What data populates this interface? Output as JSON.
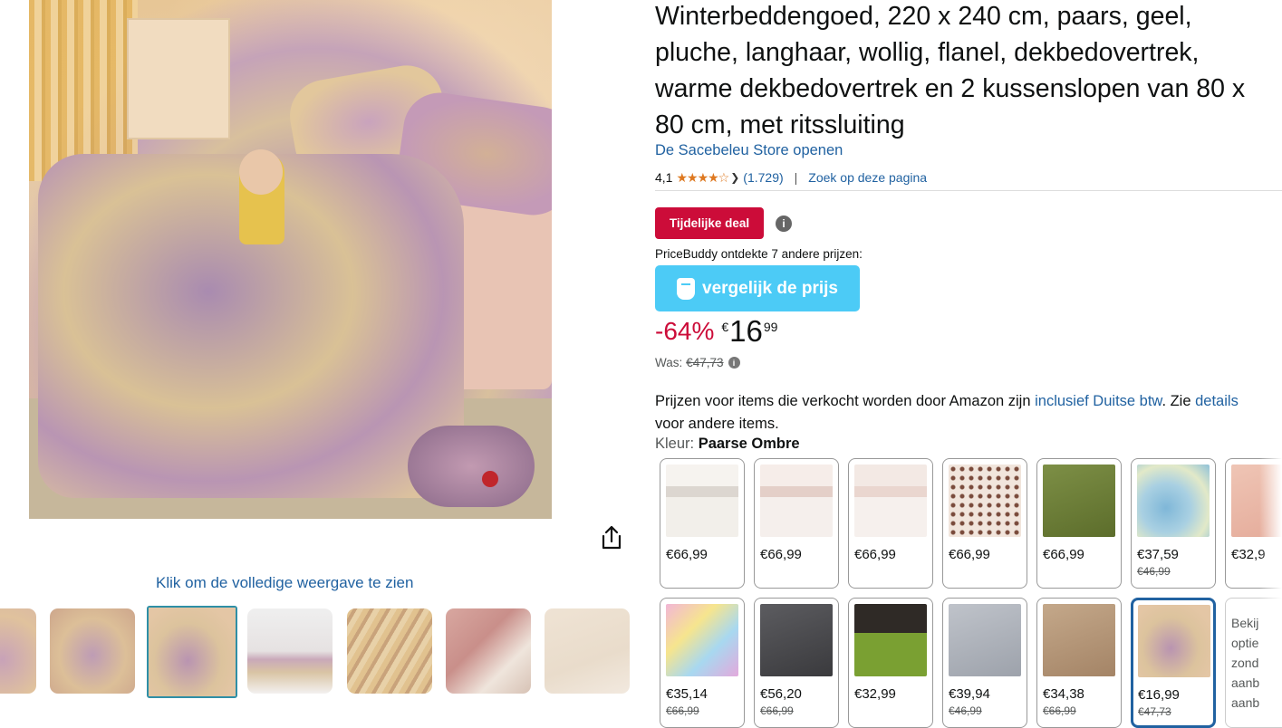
{
  "gallery": {
    "full_view_label": "Klik om de volledige weergave te zien",
    "thumbnails": 7,
    "selected_index": 2
  },
  "product": {
    "title_lines": [
      "Winterbeddengoed, 220 x 240 cm, paars, geel,",
      "pluche, langhaar, wollig, flanel, dekbedovertrek,",
      "warme dekbedovertrek en 2 kussenslopen van 80 x",
      "80 cm, met ritssluiting"
    ],
    "store_link": "De Sacebeleu Store openen",
    "rating": "4,1",
    "stars": "★★★★☆",
    "rating_count": "(1.729)",
    "search_link": "Zoek op deze pagina"
  },
  "deal": {
    "badge": "Tijdelijke deal",
    "pricebuddy_text": "PriceBuddy ontdekte 7 andere prijzen:",
    "compare_label": "vergelijk de prijs"
  },
  "price": {
    "discount": "-64%",
    "currency": "€",
    "whole": "16",
    "fraction": "99",
    "was_label": "Was:",
    "was_value": "€47,73"
  },
  "vat": {
    "part1": "Prijzen voor items die verkocht worden door Amazon zijn ",
    "link1": "inclusief Duitse btw",
    "part2": ". Zie ",
    "link2": "details",
    "line2": "voor andere items."
  },
  "color": {
    "label": "Kleur:",
    "value": "Paarse Ombre"
  },
  "swatches": [
    {
      "price": "€66,99",
      "old": "",
      "color": "#e9e2da"
    },
    {
      "price": "€66,99",
      "old": "",
      "color": "#ece4e0"
    },
    {
      "price": "€66,99",
      "old": "",
      "color": "#eee3de"
    },
    {
      "price": "€66,99",
      "old": "",
      "color": "#e8d4c8"
    },
    {
      "price": "€66,99",
      "old": "",
      "color": "#6b7d3a"
    },
    {
      "price": "€37,59",
      "old": "€46,99",
      "color": "#7fb5d6"
    },
    {
      "price": "€32,9",
      "old": "",
      "color": "#e6b7a7"
    },
    {
      "price": "€35,14",
      "old": "€66,99",
      "color": "#e7b7d3"
    },
    {
      "price": "€56,20",
      "old": "€66,99",
      "color": "#4a4a4c"
    },
    {
      "price": "€32,99",
      "old": "",
      "color": "#6e8c2d"
    },
    {
      "price": "€39,94",
      "old": "€46,99",
      "color": "#a7acb5"
    },
    {
      "price": "€34,38",
      "old": "€66,99",
      "color": "#b59a7f"
    },
    {
      "price": "€16,99",
      "old": "€47,73",
      "color": "#c9a3b6"
    },
    {
      "more": [
        "Bekij",
        "optie",
        "zond",
        "aanb",
        "aanb"
      ]
    }
  ]
}
